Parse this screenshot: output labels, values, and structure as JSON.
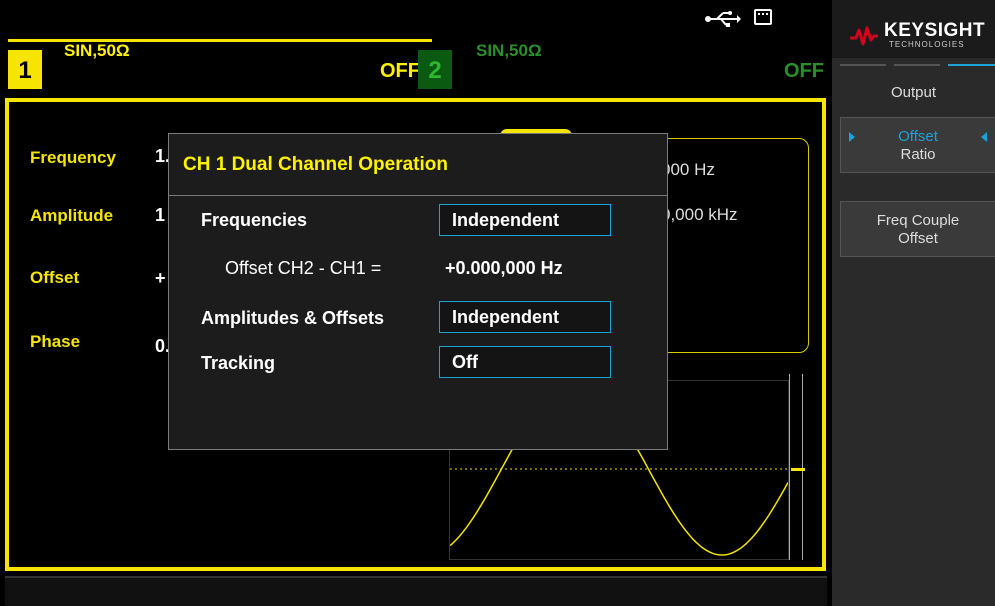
{
  "status": {
    "usb_icon": "usb-icon",
    "memory_icon": "memory-icon"
  },
  "channel1": {
    "number": "1",
    "mode": "SIN,50Ω",
    "output": "OFF",
    "color": "#f5e500"
  },
  "channel2": {
    "number": "2",
    "mode": "SIN,50Ω",
    "output": "OFF",
    "color": "#0a5a12"
  },
  "params": [
    {
      "label": "Frequency",
      "value": "1."
    },
    {
      "label": "Amplitude",
      "value": "1"
    },
    {
      "label": "Offset",
      "value": "+"
    },
    {
      "label": "Phase",
      "value": "0."
    }
  ],
  "sweep": {
    "line1": "000  Hz",
    "line2": "0,000 kHz"
  },
  "dialog": {
    "title": "CH 1 Dual Channel Operation",
    "frequencies_label": "Frequencies",
    "frequencies_value": "Independent",
    "offset_label": "Offset CH2 - CH1 =",
    "offset_value": "+0.000,000  Hz",
    "amplitudes_label": "Amplitudes & Offsets",
    "amplitudes_value": "Independent",
    "tracking_label": "Tracking",
    "tracking_value": "Off",
    "accent_color": "#1aa3d9"
  },
  "menu": {
    "brand": "KEYSIGHT",
    "brand_sub": "TECHNOLOGIES",
    "title": "Output",
    "softkeys": [
      {
        "line1": "Offset",
        "line2": "Ratio",
        "selected": true
      },
      {
        "line1": "Freq Couple",
        "line2": "Offset",
        "selected": false
      }
    ]
  }
}
